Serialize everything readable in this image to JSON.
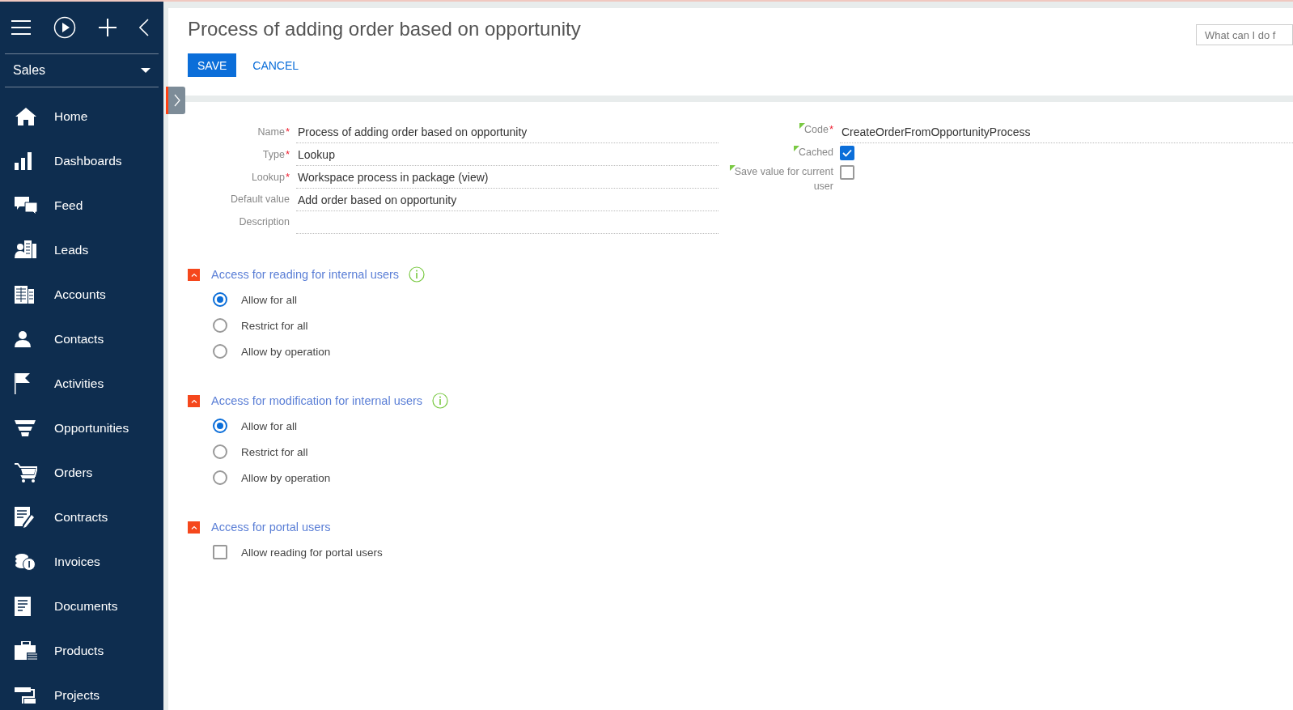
{
  "sidebar": {
    "workplace": "Sales",
    "items": [
      {
        "label": "Home"
      },
      {
        "label": "Dashboards"
      },
      {
        "label": "Feed"
      },
      {
        "label": "Leads"
      },
      {
        "label": "Accounts"
      },
      {
        "label": "Contacts"
      },
      {
        "label": "Activities"
      },
      {
        "label": "Opportunities"
      },
      {
        "label": "Orders"
      },
      {
        "label": "Contracts"
      },
      {
        "label": "Invoices"
      },
      {
        "label": "Documents"
      },
      {
        "label": "Products"
      },
      {
        "label": "Projects"
      }
    ]
  },
  "page": {
    "title": "Process of adding order based on opportunity",
    "search": {
      "placeholder": "What can I do f"
    },
    "buttons": [
      {
        "label": "SAVE",
        "kind": "primary"
      },
      {
        "label": "CANCEL",
        "kind": "link"
      }
    ]
  },
  "fields_left": [
    {
      "label": "Name",
      "required_mark": "*",
      "value": "Process of adding order based on opportunity"
    },
    {
      "label": "Type",
      "required_mark": "*",
      "value": "Lookup"
    },
    {
      "label": "Lookup",
      "required_mark": "*",
      "value": "Workspace process in package (view)"
    },
    {
      "label": "Default value",
      "value": "Add order based on opportunity"
    },
    {
      "label": "Description"
    }
  ],
  "fields_right": [
    {
      "kind": "text",
      "label": "Code",
      "required_mark": "*",
      "flagged": true,
      "value": "CreateOrderFromOpportunityProcess"
    },
    {
      "kind": "checkbox",
      "label": "Cached",
      "flagged": true,
      "checked": true
    },
    {
      "kind": "checkbox",
      "label": "Save value for current user",
      "flagged": true,
      "checked": false
    }
  ],
  "sections": [
    {
      "title": "Access for reading for internal users",
      "expanded": true,
      "info": true,
      "options": [
        {
          "kind": "radio",
          "label": "Allow for all",
          "selected": true
        },
        {
          "kind": "radio",
          "label": "Restrict for all",
          "selected": false
        },
        {
          "kind": "radio",
          "label": "Allow by operation",
          "selected": false
        }
      ]
    },
    {
      "title": "Access for modification for internal users",
      "expanded": true,
      "info": true,
      "options": [
        {
          "kind": "radio",
          "label": "Allow for all",
          "selected": true
        },
        {
          "kind": "radio",
          "label": "Restrict for all",
          "selected": false
        },
        {
          "kind": "radio",
          "label": "Allow by operation",
          "selected": false
        }
      ]
    },
    {
      "title": "Access for portal users",
      "expanded": true,
      "options": [
        {
          "kind": "checkbox",
          "label": "Allow reading for portal users",
          "checked": false
        }
      ]
    }
  ]
}
